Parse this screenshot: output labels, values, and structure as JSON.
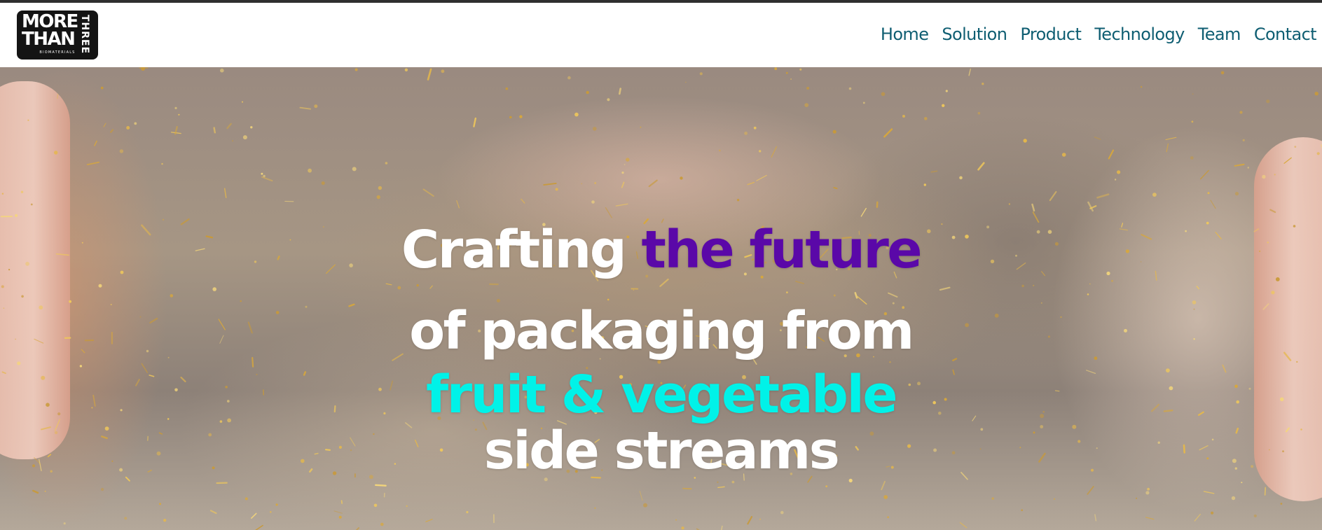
{
  "header": {
    "logo": {
      "line1": "MORE",
      "line2": "THAN",
      "vertical": "THREE",
      "subtitle": "BIOMATERIALS"
    },
    "nav": {
      "home": "Home",
      "solution": "Solution",
      "product": "Product",
      "technology": "Technology",
      "team": "Team",
      "contact": "Contact"
    }
  },
  "hero": {
    "line1": {
      "white": "Crafting ",
      "accent": "the future"
    },
    "line2": "of packaging from",
    "line3": "fruit & vegetable",
    "line4": "side streams"
  },
  "colors": {
    "nav_text": "#0f5e72",
    "headline_white": "#ffffff",
    "headline_purple": "#5a08a8",
    "headline_cyan": "#00f2e8"
  }
}
